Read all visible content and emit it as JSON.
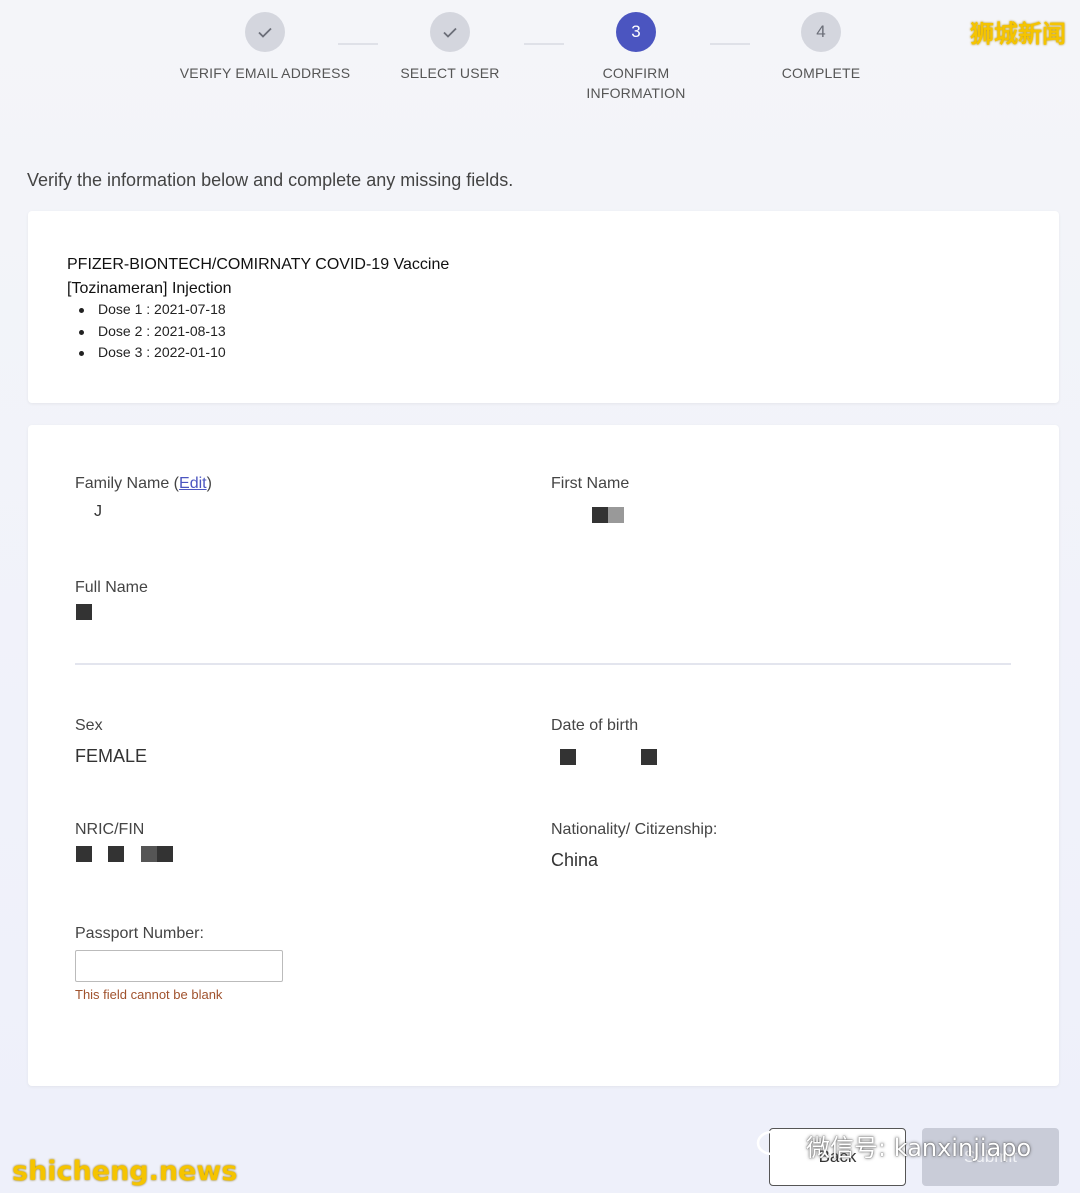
{
  "stepper": [
    {
      "index": "1",
      "label": "VERIFY EMAIL ADDRESS",
      "state": "completed",
      "icon": "check-icon"
    },
    {
      "index": "2",
      "label": "SELECT USER",
      "state": "completed",
      "icon": "check-icon"
    },
    {
      "index": "3",
      "label": "CONFIRM INFORMATION",
      "state": "active"
    },
    {
      "index": "4",
      "label": "COMPLETE",
      "state": "pending"
    }
  ],
  "instruction": "Verify the information below and complete any missing fields.",
  "vaccine": {
    "name": "PFIZER-BIONTECH/COMIRNATY COVID-19 Vaccine [Tozinameran] Injection",
    "doses": [
      "Dose 1 : 2021-07-18",
      "Dose 2 : 2021-08-13",
      "Dose 3 : 2022-01-10"
    ]
  },
  "form": {
    "family_name_label": "Family Name",
    "edit_link": "Edit",
    "family_name_value": "J",
    "first_name_label": "First Name",
    "full_name_label": "Full Name",
    "sex_label": "Sex",
    "sex_value": "FEMALE",
    "dob_label": "Date of birth",
    "nric_label": "NRIC/FIN",
    "nationality_label": "Nationality/ Citizenship:",
    "nationality_value": "China",
    "passport_label": "Passport Number:",
    "passport_value": "",
    "passport_error": "This field cannot be blank"
  },
  "buttons": {
    "back": "Back",
    "submit": "Submit"
  },
  "watermarks": {
    "top_right": "狮城新闻",
    "bottom_left": "shicheng.news",
    "wechat": "微信号: kanxinjiapo"
  },
  "colors": {
    "accent": "#4b55c0",
    "error": "#a0522d",
    "watermark": "#f5c400"
  }
}
